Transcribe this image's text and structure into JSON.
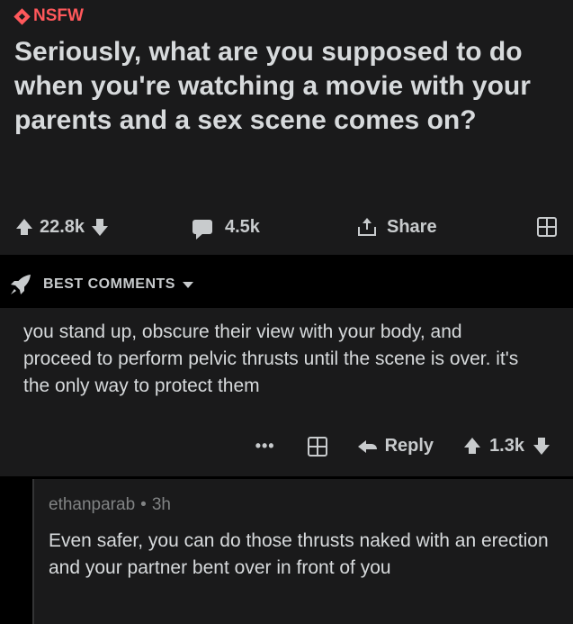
{
  "post": {
    "nsfw_label": "NSFW",
    "title": "Seriously, what are you supposed to do when you're watching a movie with your parents and a sex scene comes on?",
    "votes": "22.8k",
    "comments_count": "4.5k",
    "share_label": "Share"
  },
  "comments_header": {
    "sort_label": "BEST COMMENTS"
  },
  "comments": [
    {
      "text": "you stand up, obscure their view with your body, and proceed to perform pelvic thrusts until the scene is over. it's the only way to protect them",
      "more_label": "•••",
      "reply_label": "Reply",
      "votes": "1.3k"
    },
    {
      "author": "ethanparab",
      "separator": "•",
      "age": "3h",
      "text": "Even safer, you can do those thrusts naked with an erection and your partner bent over in front of you"
    }
  ],
  "colors": {
    "nsfw": "#ff585b",
    "panel": "#1a1a1b",
    "text": "#d7dadc",
    "muted": "#818384"
  }
}
